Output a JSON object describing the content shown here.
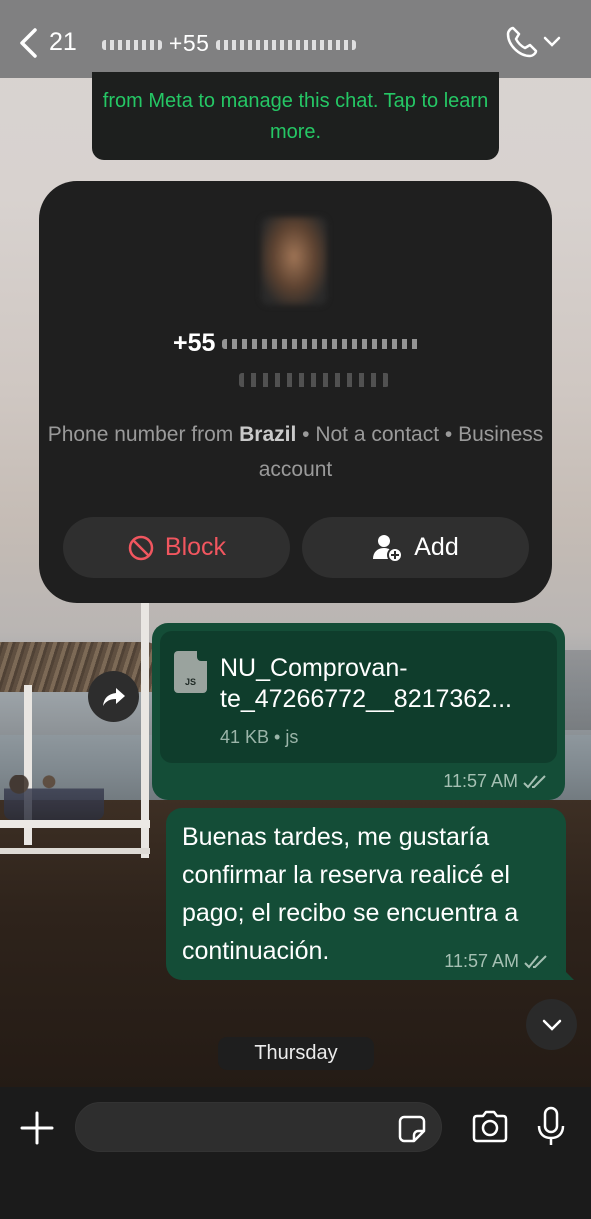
{
  "header": {
    "back_count": "21",
    "contact_name": "+55",
    "icons": [
      "chevron-left-icon",
      "phone-icon",
      "chevron-down-icon"
    ]
  },
  "notice": {
    "text": "from Meta to manage this chat. Tap to learn more."
  },
  "contact_card": {
    "number": "+55",
    "desc_prefix": "Phone number from ",
    "country": "Brazil",
    "desc_suffix": " • Not a contact • Business account",
    "block_label": "Block",
    "add_label": "Add",
    "colors": {
      "block": "#f1565f",
      "card": "#1f1f1f"
    }
  },
  "messages": [
    {
      "type": "file",
      "file_icon": "JS",
      "file_name": "NU_Comprovan-te_47266772__8217362...",
      "file_meta": "41 KB • js",
      "time": "11:57 AM",
      "status": "read"
    },
    {
      "type": "text",
      "text": "Buenas tardes, me gustaría confirmar la reserva  realicé el pago; el recibo se encuentra a continuación.",
      "time": "11:57 AM",
      "status": "read"
    }
  ],
  "date_chip": "Thursday",
  "composer": {
    "placeholder": "",
    "icons": [
      "plus-icon",
      "sticker-icon",
      "camera-icon",
      "microphone-icon"
    ]
  },
  "colors": {
    "bubble_outgoing": "#144d37",
    "notice_text": "#25c765",
    "header_bg": "#787878"
  }
}
